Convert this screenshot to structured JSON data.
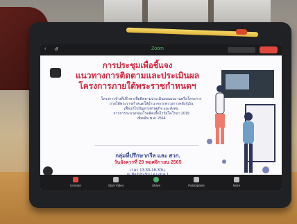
{
  "meeting": {
    "app_label": "Zoom",
    "title_line1": "การประชุมเพื่อชี้แจง",
    "title_line2": "แนวทางการติดตามและประเมินผล",
    "title_line3": "โครงการภายใต้พระราชกำหนดฯ",
    "desc_line1": "โครงการจ้างที่ปรึกษาเพื่อติดตามประเมินผลแผนงานหรือโครงการ",
    "desc_line2": "ภายใต้พระราชกำหนดให้อำนาจกระทรวงการคลังกู้เงิน",
    "desc_line3": "เพื่อแก้ไขปัญหาเศรษฐกิจ และสังคม",
    "desc_line4": "จากการระบาดของโรคติดเชื้อไวรัสโคโรนา 2019",
    "desc_line5": "เพิ่มเติม พ.ศ. 2564",
    "group": "กลุ่มที่ปรึกษากรีล และ สวก.",
    "date": "วันอังคารที่ 29 พฤศจิกายน 2565",
    "time": "เวลา 13.30-16.30น.",
    "room": "ณ ห้องประชุม Le Lotus 1"
  },
  "toolbar": {
    "mute": "Unmute",
    "video": "Start Video",
    "share": "Share",
    "participants": "Participants",
    "more": "More"
  },
  "icons": [
    "back-icon",
    "share-icon",
    "video-icon",
    "pen-icon",
    "mic-icon",
    "camera-icon",
    "share-screen-icon",
    "participants-icon",
    "more-icon",
    "virus-icon"
  ],
  "colors": {
    "title_red": "#d7253d",
    "body_blue": "#2d3f8c",
    "leave_red": "#e0473d",
    "table_wood": "#c49a66"
  }
}
